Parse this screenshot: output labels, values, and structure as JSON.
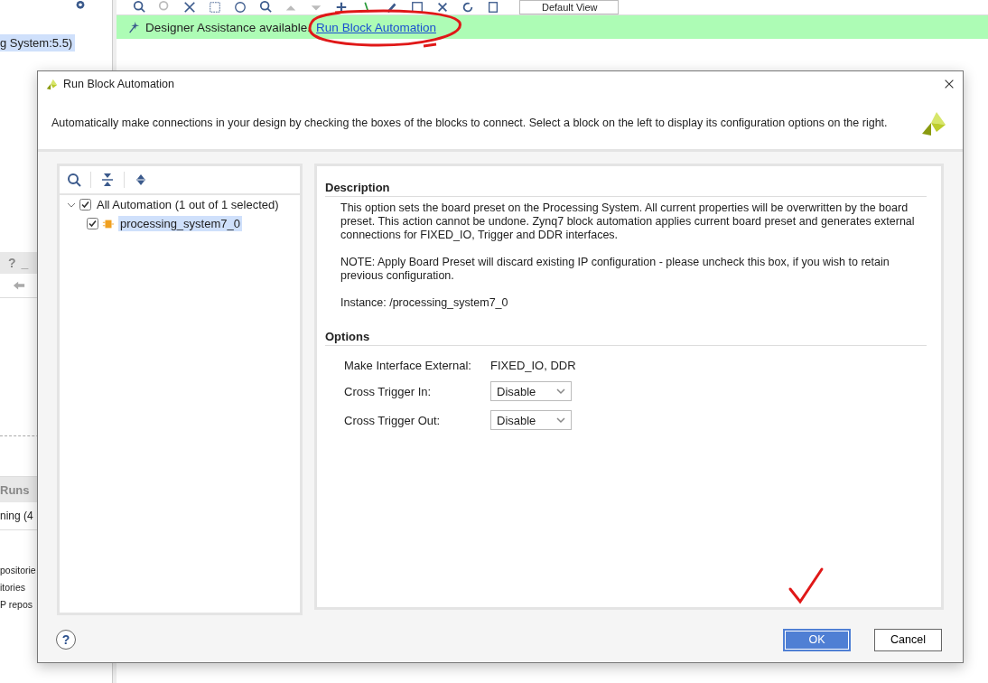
{
  "ide": {
    "toolbar": {
      "view_dropdown": "Default View"
    },
    "assistance_bar": {
      "message": "Designer Assistance available.",
      "link": "Run Block Automation"
    },
    "left_panel": {
      "selected_item": "g System:5.5)",
      "help_button": "?",
      "minimize_button": "_",
      "runs_tab": "Runs",
      "run_row": "ning (4",
      "lines": [
        "positorie",
        "itories",
        "P repos"
      ]
    }
  },
  "dialog": {
    "title": "Run Block Automation",
    "intro": "Automatically make connections in your design by checking the boxes of the blocks to connect. Select a block on the left to display its configuration options on the right.",
    "tree": [
      {
        "label": "All Automation (1 out of 1 selected)",
        "checked": true,
        "expanded": true,
        "selected": false,
        "children": [
          {
            "label": "processing_system7_0",
            "checked": true,
            "selected": true
          }
        ]
      }
    ],
    "description": {
      "heading": "Description",
      "paragraphs": [
        "This option sets the board preset on the Processing System. All current properties will be overwritten by the board preset. This action cannot be undone. Zynq7 block automation applies current board preset and generates external connections for FIXED_IO, Trigger and DDR interfaces.",
        "NOTE: Apply Board Preset will discard existing IP configuration - please uncheck this box, if you wish to retain previous configuration.",
        "Instance: /processing_system7_0"
      ]
    },
    "options": {
      "heading": "Options",
      "rows": [
        {
          "kind": "text",
          "label": "Make Interface External:",
          "value": "FIXED_IO, DDR"
        },
        {
          "kind": "dropdown",
          "label": "Cross Trigger In:",
          "value": "Disable"
        },
        {
          "kind": "dropdown",
          "label": "Cross Trigger Out:",
          "value": "Disable"
        }
      ]
    },
    "help_button": "?",
    "buttons": [
      {
        "label": "OK",
        "default": true
      },
      {
        "label": "Cancel",
        "default": false
      }
    ]
  },
  "annotations": [
    {
      "kind": "ellipse"
    },
    {
      "kind": "check"
    }
  ]
}
